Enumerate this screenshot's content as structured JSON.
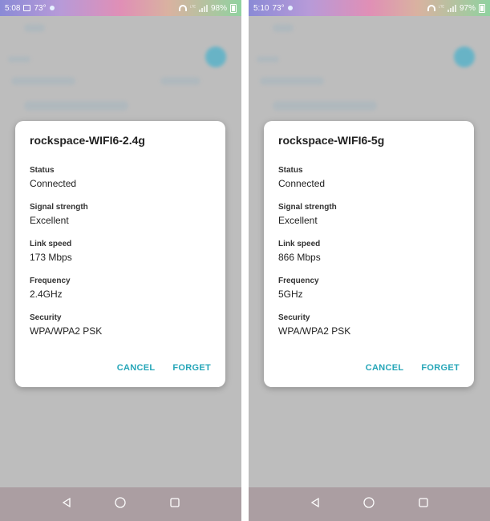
{
  "screens": [
    {
      "status": {
        "time": "5:08",
        "temp": "73°",
        "network": "ᴸᵀᴱ",
        "battery": "98%"
      },
      "dialog": {
        "title": "rockspace-WIFI6-2.4g",
        "fields": [
          {
            "label": "Status",
            "value": "Connected"
          },
          {
            "label": "Signal strength",
            "value": "Excellent"
          },
          {
            "label": "Link speed",
            "value": "173 Mbps"
          },
          {
            "label": "Frequency",
            "value": "2.4GHz"
          },
          {
            "label": "Security",
            "value": "WPA/WPA2 PSK"
          }
        ],
        "cancel_label": "CANCEL",
        "forget_label": "FORGET"
      }
    },
    {
      "status": {
        "time": "5:10",
        "temp": "73°",
        "network": "ᴸᵀᴱ",
        "battery": "97%"
      },
      "dialog": {
        "title": "rockspace-WIFI6-5g",
        "fields": [
          {
            "label": "Status",
            "value": "Connected"
          },
          {
            "label": "Signal strength",
            "value": "Excellent"
          },
          {
            "label": "Link speed",
            "value": "866 Mbps"
          },
          {
            "label": "Frequency",
            "value": "5GHz"
          },
          {
            "label": "Security",
            "value": "WPA/WPA2 PSK"
          }
        ],
        "cancel_label": "CANCEL",
        "forget_label": "FORGET"
      }
    }
  ],
  "icons": {
    "status": [
      "image-icon",
      "weather-icon",
      "wifi-icon",
      "signal-icon",
      "battery-icon"
    ],
    "nav": [
      "back-icon",
      "home-icon",
      "recents-icon"
    ]
  },
  "colors": {
    "accent": "#26a6b8",
    "scrim": "#bdbdbd",
    "nav_bar": "#ab9ea2"
  }
}
